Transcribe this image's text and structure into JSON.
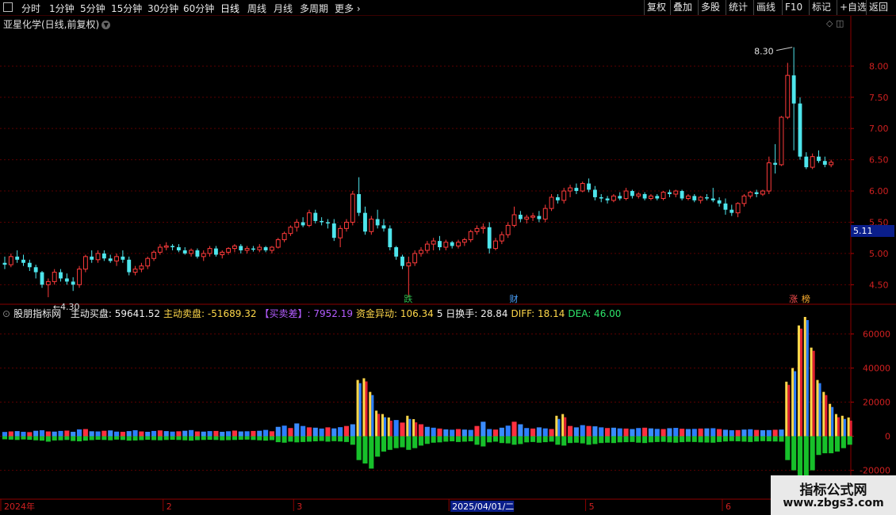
{
  "toolbar": {
    "periods": [
      "分时",
      "1分钟",
      "5分钟",
      "15分钟",
      "30分钟",
      "60分钟",
      "日线",
      "周线",
      "月线",
      "多周期",
      "更多"
    ],
    "active_period": "日线",
    "right_buttons": [
      "复权",
      "叠加",
      "多股",
      "统计",
      "画线",
      "F10",
      "标记",
      "+自选",
      "返回"
    ]
  },
  "title": "亚星化学(日线,前复权)",
  "price_tag": "5.11",
  "indicator_bar": {
    "name": "股朋指标网",
    "items": [
      {
        "label": "主动买盘:",
        "value": "59641.52",
        "color": "#f0f0f0"
      },
      {
        "label": "主动卖盘:",
        "value": "-51689.32",
        "color": "#ffd84a"
      },
      {
        "label": "【买卖差】:",
        "value": "7952.19",
        "color": "#b35cff"
      },
      {
        "label": "资金异动:",
        "value": "106.34",
        "color": "#ffd84a"
      },
      {
        "label": "5 日换手:",
        "value": "28.84",
        "color": "#f0f0f0"
      },
      {
        "label": "DIFF:",
        "value": "18.14",
        "color": "#ffd84a"
      },
      {
        "label": "DEA:",
        "value": "46.00",
        "color": "#2ee66b"
      }
    ]
  },
  "watermark": {
    "line1": "指标公式网",
    "line2": "www.zbgs3.com"
  },
  "chart_data": [
    {
      "type": "candlestick",
      "title": "亚星化学(日线,前复权)",
      "ylim": [
        4.2,
        8.6
      ],
      "y_ticks": [
        4.5,
        5.0,
        5.5,
        6.0,
        6.5,
        7.0,
        7.5,
        8.0
      ],
      "y_tick_labels": [
        "4.50",
        "5.00",
        "5.50",
        "6.00",
        "6.50",
        "7.00",
        "7.50",
        "8.00"
      ],
      "annotations": {
        "high": "8.30",
        "low": "4.30"
      },
      "event_markers": [
        "跌",
        "财",
        "涨",
        "榜"
      ],
      "x_labels": [
        "2024年",
        "2",
        "3",
        "2025/04/01/二",
        "5",
        "6"
      ],
      "ohlc": [
        [
          4.85,
          4.95,
          4.75,
          4.82
        ],
        [
          4.82,
          5.0,
          4.78,
          4.95
        ],
        [
          4.95,
          5.05,
          4.85,
          4.9
        ],
        [
          4.9,
          4.98,
          4.8,
          4.85
        ],
        [
          4.85,
          4.9,
          4.72,
          4.78
        ],
        [
          4.78,
          4.82,
          4.6,
          4.7
        ],
        [
          4.7,
          4.72,
          4.45,
          4.5
        ],
        [
          4.5,
          4.6,
          4.3,
          4.55
        ],
        [
          4.55,
          4.75,
          4.5,
          4.7
        ],
        [
          4.7,
          4.75,
          4.55,
          4.6
        ],
        [
          4.6,
          4.68,
          4.5,
          4.55
        ],
        [
          4.55,
          4.62,
          4.4,
          4.5
        ],
        [
          4.5,
          4.8,
          4.45,
          4.75
        ],
        [
          4.75,
          4.98,
          4.7,
          4.95
        ],
        [
          4.95,
          5.05,
          4.85,
          4.9
        ],
        [
          4.9,
          5.05,
          4.85,
          5.0
        ],
        [
          5.0,
          5.05,
          4.88,
          4.92
        ],
        [
          4.92,
          4.98,
          4.85,
          4.88
        ],
        [
          4.88,
          5.0,
          4.8,
          4.95
        ],
        [
          4.95,
          5.05,
          4.85,
          4.9
        ],
        [
          4.9,
          4.95,
          4.65,
          4.7
        ],
        [
          4.7,
          4.8,
          4.65,
          4.75
        ],
        [
          4.75,
          4.85,
          4.7,
          4.8
        ],
        [
          4.8,
          4.95,
          4.75,
          4.92
        ],
        [
          4.92,
          5.05,
          4.88,
          5.02
        ],
        [
          5.02,
          5.15,
          4.98,
          5.1
        ],
        [
          5.1,
          5.18,
          5.05,
          5.12
        ],
        [
          5.12,
          5.15,
          5.05,
          5.1
        ],
        [
          5.1,
          5.15,
          5.02,
          5.05
        ],
        [
          5.05,
          5.1,
          4.98,
          5.0
        ],
        [
          5.0,
          5.08,
          4.95,
          5.05
        ],
        [
          5.05,
          5.08,
          4.92,
          4.95
        ],
        [
          4.95,
          5.05,
          4.88,
          5.0
        ],
        [
          5.0,
          5.12,
          4.95,
          5.08
        ],
        [
          5.08,
          5.12,
          4.95,
          4.98
        ],
        [
          4.98,
          5.05,
          4.92,
          5.02
        ],
        [
          5.02,
          5.1,
          4.98,
          5.08
        ],
        [
          5.08,
          5.15,
          5.02,
          5.12
        ],
        [
          5.12,
          5.15,
          5.0,
          5.05
        ],
        [
          5.05,
          5.12,
          5.0,
          5.08
        ],
        [
          5.08,
          5.12,
          5.03,
          5.06
        ],
        [
          5.06,
          5.15,
          5.02,
          5.1
        ],
        [
          5.1,
          5.12,
          5.02,
          5.05
        ],
        [
          5.05,
          5.12,
          5.0,
          5.1
        ],
        [
          5.1,
          5.25,
          5.08,
          5.22
        ],
        [
          5.22,
          5.35,
          5.18,
          5.32
        ],
        [
          5.32,
          5.45,
          5.28,
          5.42
        ],
        [
          5.42,
          5.55,
          5.35,
          5.5
        ],
        [
          5.5,
          5.58,
          5.42,
          5.45
        ],
        [
          5.45,
          5.7,
          5.42,
          5.65
        ],
        [
          5.65,
          5.7,
          5.48,
          5.52
        ],
        [
          5.52,
          5.58,
          5.45,
          5.5
        ],
        [
          5.5,
          5.55,
          5.4,
          5.48
        ],
        [
          5.48,
          5.55,
          5.2,
          5.25
        ],
        [
          5.25,
          5.45,
          5.1,
          5.4
        ],
        [
          5.4,
          5.55,
          5.35,
          5.5
        ],
        [
          5.5,
          6.0,
          5.45,
          5.95
        ],
        [
          5.95,
          6.22,
          5.6,
          5.65
        ],
        [
          5.65,
          5.75,
          5.3,
          5.35
        ],
        [
          5.35,
          5.6,
          5.3,
          5.55
        ],
        [
          5.55,
          5.7,
          5.4,
          5.45
        ],
        [
          5.45,
          5.55,
          5.35,
          5.4
        ],
        [
          5.4,
          5.45,
          5.05,
          5.1
        ],
        [
          5.1,
          5.12,
          4.9,
          4.95
        ],
        [
          4.95,
          4.98,
          4.75,
          4.8
        ],
        [
          4.8,
          4.95,
          4.3,
          4.85
        ],
        [
          4.85,
          5.05,
          4.8,
          5.0
        ],
        [
          5.0,
          5.1,
          4.95,
          5.05
        ],
        [
          5.05,
          5.2,
          5.0,
          5.15
        ],
        [
          5.15,
          5.25,
          5.05,
          5.2
        ],
        [
          5.2,
          5.28,
          5.05,
          5.1
        ],
        [
          5.1,
          5.22,
          5.05,
          5.18
        ],
        [
          5.18,
          5.2,
          5.08,
          5.12
        ],
        [
          5.12,
          5.22,
          5.08,
          5.18
        ],
        [
          5.18,
          5.25,
          5.12,
          5.22
        ],
        [
          5.22,
          5.38,
          5.18,
          5.35
        ],
        [
          5.35,
          5.45,
          5.3,
          5.4
        ],
        [
          5.4,
          5.48,
          5.32,
          5.42
        ],
        [
          5.42,
          5.5,
          5.0,
          5.08
        ],
        [
          5.08,
          5.25,
          5.05,
          5.2
        ],
        [
          5.2,
          5.35,
          5.15,
          5.3
        ],
        [
          5.3,
          5.5,
          5.25,
          5.45
        ],
        [
          5.45,
          5.75,
          5.42,
          5.62
        ],
        [
          5.62,
          5.68,
          5.5,
          5.55
        ],
        [
          5.55,
          5.62,
          5.48,
          5.58
        ],
        [
          5.58,
          5.65,
          5.52,
          5.6
        ],
        [
          5.6,
          5.68,
          5.5,
          5.55
        ],
        [
          5.55,
          5.78,
          5.5,
          5.72
        ],
        [
          5.72,
          5.95,
          5.68,
          5.9
        ],
        [
          5.9,
          5.95,
          5.8,
          5.85
        ],
        [
          5.85,
          6.05,
          5.8,
          6.0
        ],
        [
          6.0,
          6.1,
          5.9,
          6.05
        ],
        [
          6.05,
          6.12,
          5.95,
          6.0
        ],
        [
          6.0,
          6.15,
          5.98,
          6.12
        ],
        [
          6.12,
          6.2,
          5.98,
          6.02
        ],
        [
          6.02,
          6.08,
          5.85,
          5.9
        ],
        [
          5.9,
          5.95,
          5.82,
          5.88
        ],
        [
          5.88,
          5.92,
          5.8,
          5.85
        ],
        [
          5.85,
          5.95,
          5.82,
          5.92
        ],
        [
          5.92,
          5.98,
          5.85,
          5.88
        ],
        [
          5.88,
          6.05,
          5.85,
          6.0
        ],
        [
          6.0,
          6.02,
          5.88,
          5.92
        ],
        [
          5.92,
          5.98,
          5.88,
          5.95
        ],
        [
          5.95,
          5.98,
          5.85,
          5.88
        ],
        [
          5.88,
          5.95,
          5.85,
          5.92
        ],
        [
          5.92,
          5.95,
          5.85,
          5.88
        ],
        [
          5.88,
          6.0,
          5.85,
          5.98
        ],
        [
          5.98,
          6.02,
          5.9,
          5.95
        ],
        [
          5.95,
          6.02,
          5.9,
          6.0
        ],
        [
          6.0,
          6.02,
          5.85,
          5.88
        ],
        [
          5.88,
          5.95,
          5.85,
          5.92
        ],
        [
          5.92,
          5.95,
          5.82,
          5.85
        ],
        [
          5.85,
          5.92,
          5.8,
          5.9
        ],
        [
          5.9,
          5.95,
          5.85,
          5.88
        ],
        [
          5.88,
          6.05,
          5.82,
          5.85
        ],
        [
          5.85,
          5.9,
          5.75,
          5.8
        ],
        [
          5.8,
          5.88,
          5.62,
          5.7
        ],
        [
          5.7,
          5.78,
          5.6,
          5.65
        ],
        [
          5.65,
          5.82,
          5.58,
          5.8
        ],
        [
          5.8,
          5.95,
          5.75,
          5.92
        ],
        [
          5.92,
          6.0,
          5.88,
          5.98
        ],
        [
          5.98,
          6.02,
          5.9,
          5.95
        ],
        [
          5.95,
          6.02,
          5.92,
          6.0
        ],
        [
          6.0,
          6.55,
          5.95,
          6.45
        ],
        [
          6.45,
          6.75,
          6.28,
          6.42
        ],
        [
          6.42,
          7.2,
          6.4,
          7.18
        ],
        [
          7.18,
          8.05,
          7.15,
          7.85
        ],
        [
          7.85,
          8.3,
          6.65,
          7.4
        ],
        [
          7.4,
          7.5,
          6.5,
          6.55
        ],
        [
          6.55,
          6.62,
          6.35,
          6.38
        ],
        [
          6.38,
          6.6,
          6.35,
          6.55
        ],
        [
          6.55,
          6.65,
          6.45,
          6.48
        ],
        [
          6.48,
          6.55,
          6.38,
          6.42
        ],
        [
          6.42,
          6.5,
          6.38,
          6.46
        ]
      ]
    },
    {
      "type": "bar",
      "title": "股朋指标网",
      "ylim": [
        -36000,
        70000
      ],
      "y_ticks": [
        -20000,
        0,
        20000,
        40000,
        60000
      ],
      "y_tick_labels": [
        "-20000",
        "0",
        "20000",
        "40000",
        "60000"
      ],
      "series": [
        {
          "name": "主动买盘",
          "values": [
            2500,
            2800,
            3000,
            2600,
            2400,
            3200,
            3500,
            2800,
            2700,
            3100,
            3300,
            2600,
            4000,
            4200,
            2900,
            2800,
            3200,
            3400,
            2700,
            2600,
            3000,
            3500,
            2800,
            2600,
            3100,
            3400,
            3000,
            2700,
            2900,
            3200,
            3600,
            2800,
            2700,
            3000,
            3100,
            2600,
            2900,
            3300,
            2800,
            2900,
            3100,
            3200,
            3700,
            2900,
            5500,
            6200,
            4800,
            7500,
            6000,
            5200,
            5000,
            4500,
            5200,
            4600,
            5300,
            6000,
            7000,
            33000,
            34000,
            26000,
            15000,
            13000,
            11000,
            9500,
            8000,
            12000,
            10000,
            7000,
            5500,
            5000,
            4500,
            4000,
            3800,
            4200,
            3900,
            3700,
            6000,
            8500,
            4200,
            3900,
            5000,
            6200,
            8500,
            7000,
            4800,
            4500,
            5200,
            4600,
            4200,
            12000,
            13000,
            6000,
            5200,
            6500,
            6000,
            5800,
            5200,
            4800,
            5000,
            4600,
            4500,
            4200,
            4800,
            5000,
            4600,
            4300,
            4200,
            4700,
            4900,
            4400,
            4200,
            4300,
            4500,
            4600,
            4700,
            4200,
            3800,
            3500,
            3600,
            3900,
            4100,
            3700,
            3500,
            3600,
            3800,
            3900,
            32000,
            40000,
            65000,
            70000,
            52000,
            33000,
            26000,
            19000,
            13000,
            12000,
            11000
          ]
        },
        {
          "name": "主动卖盘",
          "values": [
            -1800,
            -2000,
            -2200,
            -1900,
            -2100,
            -2400,
            -2600,
            -3200,
            -2500,
            -2400,
            -2200,
            -2800,
            -3000,
            -2600,
            -2300,
            -2100,
            -2200,
            -2400,
            -2000,
            -2200,
            -2600,
            -2500,
            -2300,
            -2100,
            -2300,
            -2400,
            -2200,
            -2100,
            -2200,
            -2400,
            -2600,
            -2300,
            -2200,
            -2100,
            -2200,
            -2400,
            -2300,
            -2200,
            -2100,
            -2000,
            -2200,
            -2400,
            -2600,
            -2300,
            -3500,
            -3800,
            -3200,
            -3600,
            -3400,
            -3200,
            -3000,
            -2800,
            -3200,
            -2900,
            -3100,
            -3400,
            -5000,
            -14000,
            -16000,
            -19000,
            -12000,
            -9000,
            -8000,
            -7000,
            -6500,
            -8000,
            -7000,
            -5500,
            -4500,
            -3800,
            -3600,
            -3200,
            -3000,
            -3400,
            -3200,
            -3000,
            -5000,
            -6000,
            -3600,
            -3200,
            -4000,
            -4200,
            -5000,
            -4600,
            -3600,
            -3400,
            -3800,
            -3500,
            -3200,
            -5000,
            -5500,
            -4000,
            -3800,
            -4200,
            -5000,
            -4600,
            -4000,
            -3800,
            -4000,
            -3600,
            -3500,
            -3400,
            -3800,
            -4000,
            -3600,
            -3400,
            -3300,
            -3600,
            -3800,
            -3500,
            -3300,
            -3400,
            -3600,
            -3700,
            -3800,
            -3400,
            -3100,
            -2900,
            -3000,
            -3200,
            -3400,
            -3100,
            -2900,
            -3000,
            -3100,
            -3200,
            -14000,
            -20000,
            -28000,
            -34000,
            -20000,
            -11000,
            -10000,
            -10000,
            -9000,
            -7000,
            -5000
          ]
        }
      ]
    }
  ]
}
